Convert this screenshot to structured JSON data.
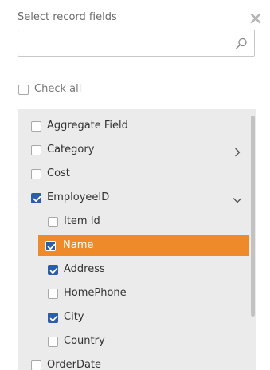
{
  "dialog": {
    "title": "Select record fields",
    "close_icon": "close-icon"
  },
  "search": {
    "value": "",
    "placeholder": "",
    "icon": "search-icon"
  },
  "check_all": {
    "label": "Check all",
    "checked": false
  },
  "fields": [
    {
      "label": "Aggregate Field",
      "checked": false,
      "level": 0,
      "expander": "none"
    },
    {
      "label": "Category",
      "checked": false,
      "level": 0,
      "expander": "chevron-right"
    },
    {
      "label": "Cost",
      "checked": false,
      "level": 0,
      "expander": "none"
    },
    {
      "label": "EmployeeID",
      "checked": true,
      "level": 0,
      "expander": "chevron-down"
    },
    {
      "label": "Item Id",
      "checked": false,
      "level": 1,
      "expander": "none"
    },
    {
      "label": "Name",
      "checked": true,
      "level": 1,
      "expander": "none",
      "selected": true
    },
    {
      "label": "Address",
      "checked": true,
      "level": 1,
      "expander": "none"
    },
    {
      "label": "HomePhone",
      "checked": false,
      "level": 1,
      "expander": "none"
    },
    {
      "label": "City",
      "checked": true,
      "level": 1,
      "expander": "none"
    },
    {
      "label": "Country",
      "checked": false,
      "level": 1,
      "expander": "none"
    },
    {
      "label": "OrderDate",
      "checked": false,
      "level": 0,
      "expander": "none"
    }
  ],
  "colors": {
    "selected_row": "#ee8a2a",
    "checkbox_checked": "#2a5ea8",
    "list_background": "#ebebeb"
  }
}
